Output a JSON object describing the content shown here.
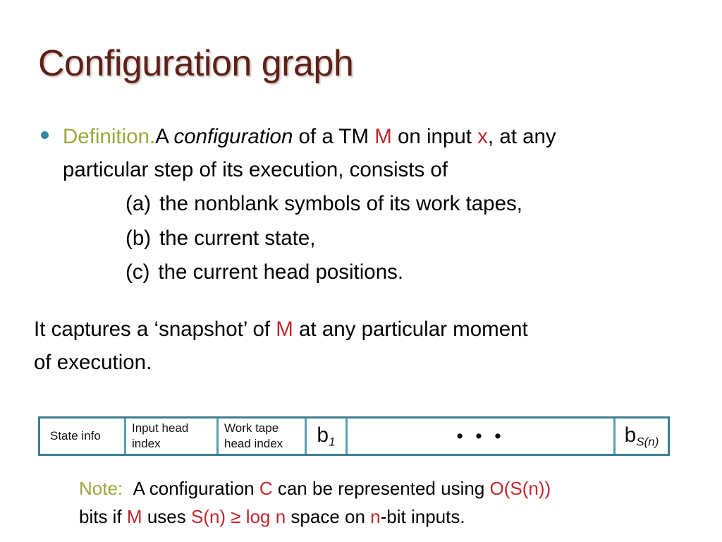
{
  "slide": {
    "title": "Configuration graph",
    "colors": {
      "title": "#5e2017",
      "olive": "#94ab3c",
      "red": "#c0282d",
      "bullet": "#3389a0",
      "table_border_outer": "#3d7d8f",
      "table_border_inner": "#57a0b4",
      "background": "#ffffff",
      "text": "#000000"
    }
  },
  "definition": {
    "label": "Definition.",
    "t1": "A ",
    "term": "configuration",
    "t2": " of a TM ",
    "machine": "M",
    "t3": " on input ",
    "input": "x",
    "t4": ", at any",
    "line2": "particular step of its execution, consists of"
  },
  "items": [
    {
      "label": "(a)",
      "text": "the nonblank symbols of its work tapes,"
    },
    {
      "label": "(b)",
      "text": "the current state,"
    },
    {
      "label": "(c)",
      "text": "the current head positions."
    }
  ],
  "captures": {
    "t1": "It captures a ‘snapshot’ of ",
    "machine": "M",
    "t2": " at any particular moment",
    "line2": "of execution."
  },
  "tape_table": {
    "cells": [
      {
        "name": "state-info",
        "text": "State info"
      },
      {
        "name": "input-head",
        "text": "Input head index"
      },
      {
        "name": "work-tape-head",
        "text": "Work tape head index"
      },
      {
        "name": "b-first",
        "base": "b",
        "sub": "1"
      },
      {
        "name": "ellipsis",
        "text": "• • •"
      },
      {
        "name": "b-last",
        "base": "b",
        "sub": "S(n)"
      }
    ]
  },
  "note": {
    "label": "Note:",
    "t1": "A configuration ",
    "config": "C",
    "t2": " can be represented using ",
    "bigo": "O(S(n))",
    "l2_t1": "bits if ",
    "l2_machine": "M",
    "l2_t2": " uses ",
    "l2_space": "S(n) ≥ log n",
    "l2_t3": " space on ",
    "l2_n": "n",
    "l2_t4": "-bit inputs."
  }
}
